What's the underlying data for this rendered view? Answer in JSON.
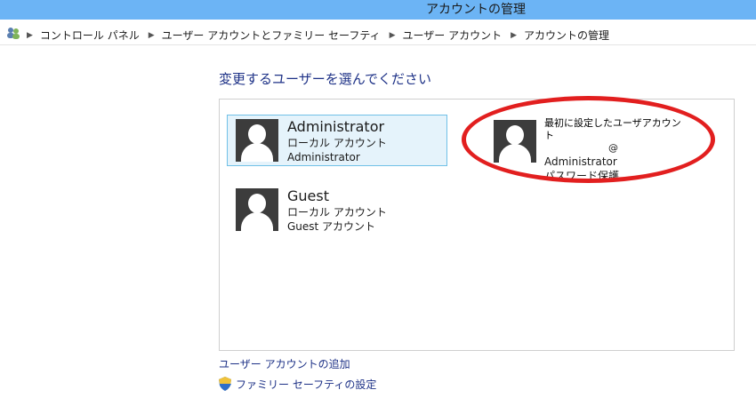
{
  "window": {
    "title": "アカウントの管理"
  },
  "address_bar": {
    "icon": "users-group-icon",
    "crumbs": [
      {
        "label": "コントロール パネル"
      },
      {
        "label": "ユーザー アカウントとファミリー セーフティ"
      },
      {
        "label": "ユーザー アカウント"
      },
      {
        "label": "アカウントの管理"
      }
    ]
  },
  "main": {
    "heading": "変更するユーザーを選んでください",
    "accounts": [
      {
        "name": "Administrator",
        "type": "ローカル アカウント",
        "detail": "Administrator",
        "selected": true
      },
      {
        "name": "Guest",
        "type": "ローカル アカウント",
        "detail": "Guest アカウント",
        "selected": false
      }
    ],
    "annotated_account": {
      "note": "最初に設定したユーザアカウント",
      "email_at": "@",
      "detail": "Administrator",
      "status": "パスワード保護"
    }
  },
  "links": {
    "add_account": "ユーザー アカウントの追加",
    "family_safety": "ファミリー セーフティの設定"
  },
  "colors": {
    "titlebar": "#6cb4f5",
    "link": "#1e3287",
    "selected_bg": "#e5f3fb",
    "selected_border": "#70c0e7",
    "annotation": "#e21f1f"
  }
}
